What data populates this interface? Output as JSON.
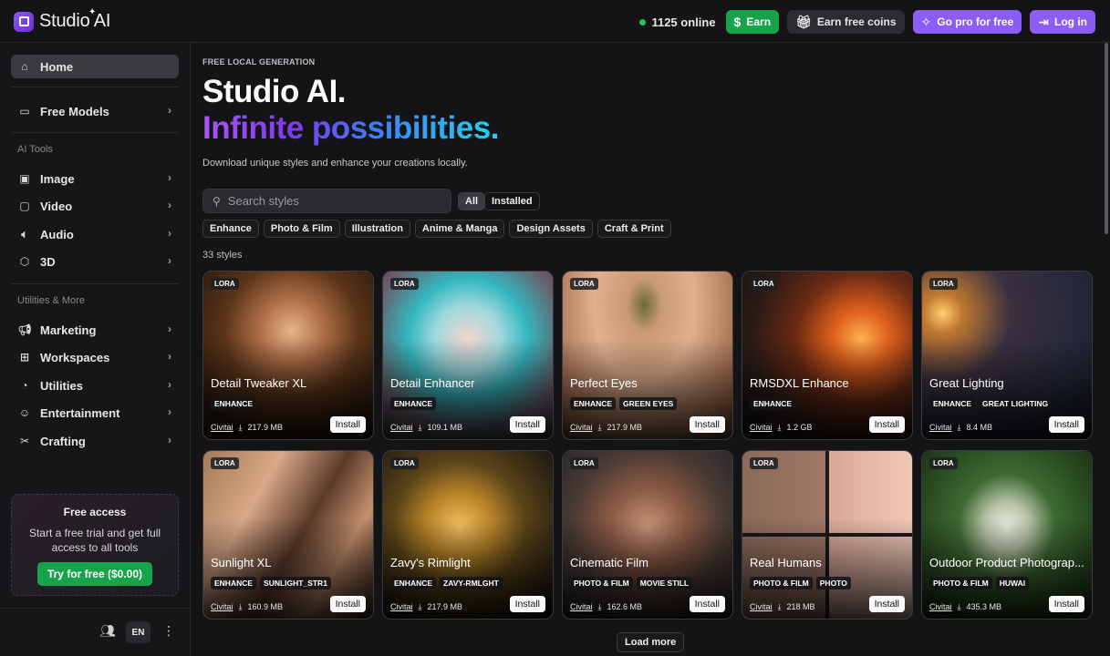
{
  "app": {
    "name": "Studio AI"
  },
  "topbar": {
    "online_count": "1125 online",
    "earn": "Earn",
    "earn_coins": "Earn free coins",
    "go_pro": "Go pro for free",
    "login": "Log in"
  },
  "sidebar": {
    "home": "Home",
    "free_models": "Free Models",
    "ai_tools_heading": "AI Tools",
    "image": "Image",
    "video": "Video",
    "audio": "Audio",
    "three_d": "3D",
    "utilities_heading": "Utilities & More",
    "marketing": "Marketing",
    "workspaces": "Workspaces",
    "utilities": "Utilities",
    "entertainment": "Entertainment",
    "crafting": "Crafting",
    "free_card": {
      "title": "Free access",
      "desc": "Start a free trial and get full access to all tools",
      "button": "Try for free ($0.00)"
    },
    "language": "EN"
  },
  "main": {
    "eyebrow": "FREE LOCAL GENERATION",
    "title": "Studio AI.",
    "subtitle": "Infinite possibilities.",
    "description": "Download unique styles and enhance your creations locally.",
    "search_placeholder": "Search styles",
    "filter_all": "All",
    "filter_installed": "Installed",
    "categories": [
      "Enhance",
      "Photo & Film",
      "Illustration",
      "Anime & Manga",
      "Design Assets",
      "Craft & Print"
    ],
    "count": "33 styles",
    "load_more": "Load more"
  },
  "cards": [
    {
      "badge": "LORA",
      "name": "Detail Tweaker XL",
      "tags": [
        "ENHANCE"
      ],
      "source": "Civitai",
      "size": "217.9 MB",
      "install": "Install"
    },
    {
      "badge": "LORA",
      "name": "Detail Enhancer",
      "tags": [
        "ENHANCE"
      ],
      "source": "Civitai",
      "size": "109.1 MB",
      "install": "Install"
    },
    {
      "badge": "LORA",
      "name": "Perfect Eyes",
      "tags": [
        "ENHANCE",
        "GREEN EYES"
      ],
      "source": "Civitai",
      "size": "217.9 MB",
      "install": "Install"
    },
    {
      "badge": "LORA",
      "name": "RMSDXL Enhance",
      "tags": [
        "ENHANCE"
      ],
      "source": "Civitai",
      "size": "1.2 GB",
      "install": "Install"
    },
    {
      "badge": "LORA",
      "name": "Great Lighting",
      "tags": [
        "ENHANCE",
        "GREAT LIGHTING"
      ],
      "source": "Civitai",
      "size": "8.4 MB",
      "install": "Install"
    },
    {
      "badge": "LORA",
      "name": "Sunlight XL",
      "tags": [
        "ENHANCE",
        "SUNLIGHT_STR1"
      ],
      "source": "Civitai",
      "size": "160.9 MB",
      "install": "Install"
    },
    {
      "badge": "LORA",
      "name": "Zavy's Rimlight",
      "tags": [
        "ENHANCE",
        "ZAVY-RMLGHT"
      ],
      "source": "Civitai",
      "size": "217.9 MB",
      "install": "Install"
    },
    {
      "badge": "LORA",
      "name": "Cinematic Film",
      "tags": [
        "PHOTO & FILM",
        "MOVIE STILL"
      ],
      "source": "Civitai",
      "size": "162.6 MB",
      "install": "Install"
    },
    {
      "badge": "LORA",
      "name": "Real Humans",
      "tags": [
        "PHOTO & FILM",
        "PHOTO"
      ],
      "source": "Civitai",
      "size": "218 MB",
      "install": "Install"
    },
    {
      "badge": "LORA",
      "name": "Outdoor Product Photograp...",
      "tags": [
        "PHOTO & FILM",
        "HUWAI"
      ],
      "source": "Civitai",
      "size": "435.3 MB",
      "install": "Install"
    }
  ]
}
